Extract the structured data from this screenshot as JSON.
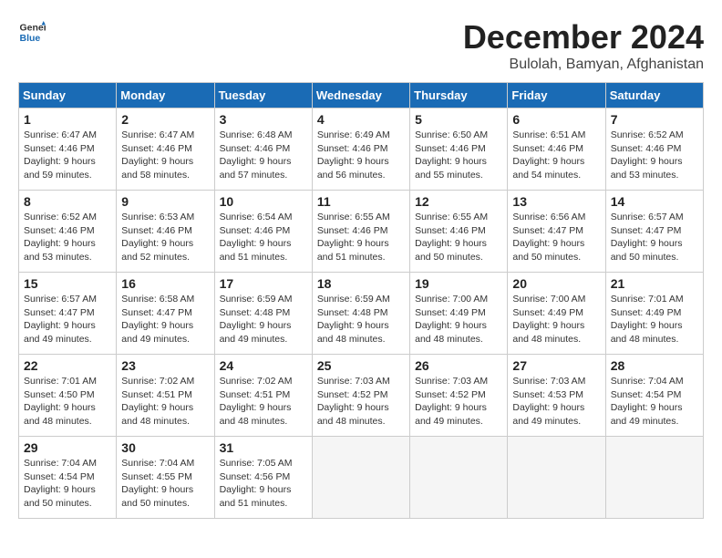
{
  "header": {
    "logo_line1": "General",
    "logo_line2": "Blue",
    "month_title": "December 2024",
    "location": "Bulolah, Bamyan, Afghanistan"
  },
  "weekdays": [
    "Sunday",
    "Monday",
    "Tuesday",
    "Wednesday",
    "Thursday",
    "Friday",
    "Saturday"
  ],
  "weeks": [
    [
      {
        "day": "1",
        "sunrise": "6:47 AM",
        "sunset": "4:46 PM",
        "daylight": "9 hours and 59 minutes."
      },
      {
        "day": "2",
        "sunrise": "6:47 AM",
        "sunset": "4:46 PM",
        "daylight": "9 hours and 58 minutes."
      },
      {
        "day": "3",
        "sunrise": "6:48 AM",
        "sunset": "4:46 PM",
        "daylight": "9 hours and 57 minutes."
      },
      {
        "day": "4",
        "sunrise": "6:49 AM",
        "sunset": "4:46 PM",
        "daylight": "9 hours and 56 minutes."
      },
      {
        "day": "5",
        "sunrise": "6:50 AM",
        "sunset": "4:46 PM",
        "daylight": "9 hours and 55 minutes."
      },
      {
        "day": "6",
        "sunrise": "6:51 AM",
        "sunset": "4:46 PM",
        "daylight": "9 hours and 54 minutes."
      },
      {
        "day": "7",
        "sunrise": "6:52 AM",
        "sunset": "4:46 PM",
        "daylight": "9 hours and 53 minutes."
      }
    ],
    [
      {
        "day": "8",
        "sunrise": "6:52 AM",
        "sunset": "4:46 PM",
        "daylight": "9 hours and 53 minutes."
      },
      {
        "day": "9",
        "sunrise": "6:53 AM",
        "sunset": "4:46 PM",
        "daylight": "9 hours and 52 minutes."
      },
      {
        "day": "10",
        "sunrise": "6:54 AM",
        "sunset": "4:46 PM",
        "daylight": "9 hours and 51 minutes."
      },
      {
        "day": "11",
        "sunrise": "6:55 AM",
        "sunset": "4:46 PM",
        "daylight": "9 hours and 51 minutes."
      },
      {
        "day": "12",
        "sunrise": "6:55 AM",
        "sunset": "4:46 PM",
        "daylight": "9 hours and 50 minutes."
      },
      {
        "day": "13",
        "sunrise": "6:56 AM",
        "sunset": "4:47 PM",
        "daylight": "9 hours and 50 minutes."
      },
      {
        "day": "14",
        "sunrise": "6:57 AM",
        "sunset": "4:47 PM",
        "daylight": "9 hours and 50 minutes."
      }
    ],
    [
      {
        "day": "15",
        "sunrise": "6:57 AM",
        "sunset": "4:47 PM",
        "daylight": "9 hours and 49 minutes."
      },
      {
        "day": "16",
        "sunrise": "6:58 AM",
        "sunset": "4:47 PM",
        "daylight": "9 hours and 49 minutes."
      },
      {
        "day": "17",
        "sunrise": "6:59 AM",
        "sunset": "4:48 PM",
        "daylight": "9 hours and 49 minutes."
      },
      {
        "day": "18",
        "sunrise": "6:59 AM",
        "sunset": "4:48 PM",
        "daylight": "9 hours and 48 minutes."
      },
      {
        "day": "19",
        "sunrise": "7:00 AM",
        "sunset": "4:49 PM",
        "daylight": "9 hours and 48 minutes."
      },
      {
        "day": "20",
        "sunrise": "7:00 AM",
        "sunset": "4:49 PM",
        "daylight": "9 hours and 48 minutes."
      },
      {
        "day": "21",
        "sunrise": "7:01 AM",
        "sunset": "4:49 PM",
        "daylight": "9 hours and 48 minutes."
      }
    ],
    [
      {
        "day": "22",
        "sunrise": "7:01 AM",
        "sunset": "4:50 PM",
        "daylight": "9 hours and 48 minutes."
      },
      {
        "day": "23",
        "sunrise": "7:02 AM",
        "sunset": "4:51 PM",
        "daylight": "9 hours and 48 minutes."
      },
      {
        "day": "24",
        "sunrise": "7:02 AM",
        "sunset": "4:51 PM",
        "daylight": "9 hours and 48 minutes."
      },
      {
        "day": "25",
        "sunrise": "7:03 AM",
        "sunset": "4:52 PM",
        "daylight": "9 hours and 48 minutes."
      },
      {
        "day": "26",
        "sunrise": "7:03 AM",
        "sunset": "4:52 PM",
        "daylight": "9 hours and 49 minutes."
      },
      {
        "day": "27",
        "sunrise": "7:03 AM",
        "sunset": "4:53 PM",
        "daylight": "9 hours and 49 minutes."
      },
      {
        "day": "28",
        "sunrise": "7:04 AM",
        "sunset": "4:54 PM",
        "daylight": "9 hours and 49 minutes."
      }
    ],
    [
      {
        "day": "29",
        "sunrise": "7:04 AM",
        "sunset": "4:54 PM",
        "daylight": "9 hours and 50 minutes."
      },
      {
        "day": "30",
        "sunrise": "7:04 AM",
        "sunset": "4:55 PM",
        "daylight": "9 hours and 50 minutes."
      },
      {
        "day": "31",
        "sunrise": "7:05 AM",
        "sunset": "4:56 PM",
        "daylight": "9 hours and 51 minutes."
      },
      null,
      null,
      null,
      null
    ]
  ]
}
